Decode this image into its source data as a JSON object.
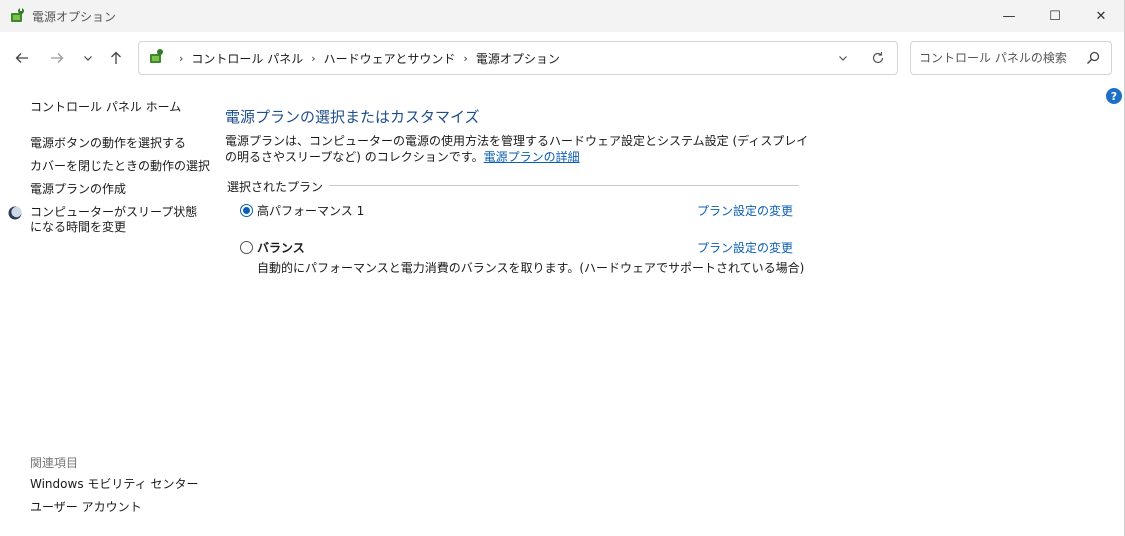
{
  "window": {
    "title": "電源オプション",
    "controls": {
      "minimize": "—",
      "maximize": "☐",
      "close": "✕"
    }
  },
  "nav": {
    "back_icon": "arrow-left-icon",
    "forward_icon": "arrow-right-icon",
    "history_icon": "chevron-down-icon",
    "up_icon": "arrow-up-icon",
    "breadcrumbs": [
      "コントロール パネル",
      "ハードウェアとサウンド",
      "電源オプション"
    ],
    "search_placeholder": "コントロール パネルの検索"
  },
  "sidebar": {
    "home": "コントロール パネル ホーム",
    "links": [
      "電源ボタンの動作を選択する",
      "カバーを閉じたときの動作の選択",
      "電源プランの作成",
      "コンピューターがスリープ状態になる時間を変更"
    ],
    "related_title": "関連項目",
    "related_links": [
      "Windows モビリティ センター",
      "ユーザー アカウント"
    ]
  },
  "main": {
    "title": "電源プランの選択またはカスタマイズ",
    "description": "電源プランは、コンピューターの電源の使用方法を管理するハードウェア設定とシステム設定 (ディスプレイの明るさやスリープなど) のコレクションです。",
    "description_link": "電源プランの詳細",
    "group_label": "選択されたプラン",
    "plans": [
      {
        "name": "高パフォーマンス 1",
        "selected": true,
        "link": "プラン設定の変更",
        "desc": ""
      },
      {
        "name": "バランス",
        "selected": false,
        "link": "プラン設定の変更",
        "desc": "自動的にパフォーマンスと電力消費のバランスを取ります。(ハードウェアでサポートされている場合)"
      }
    ]
  },
  "help": "?",
  "colors": {
    "accent": "#0a5fb4",
    "title": "#1e4e8c",
    "desktop": "#7fb83a"
  }
}
